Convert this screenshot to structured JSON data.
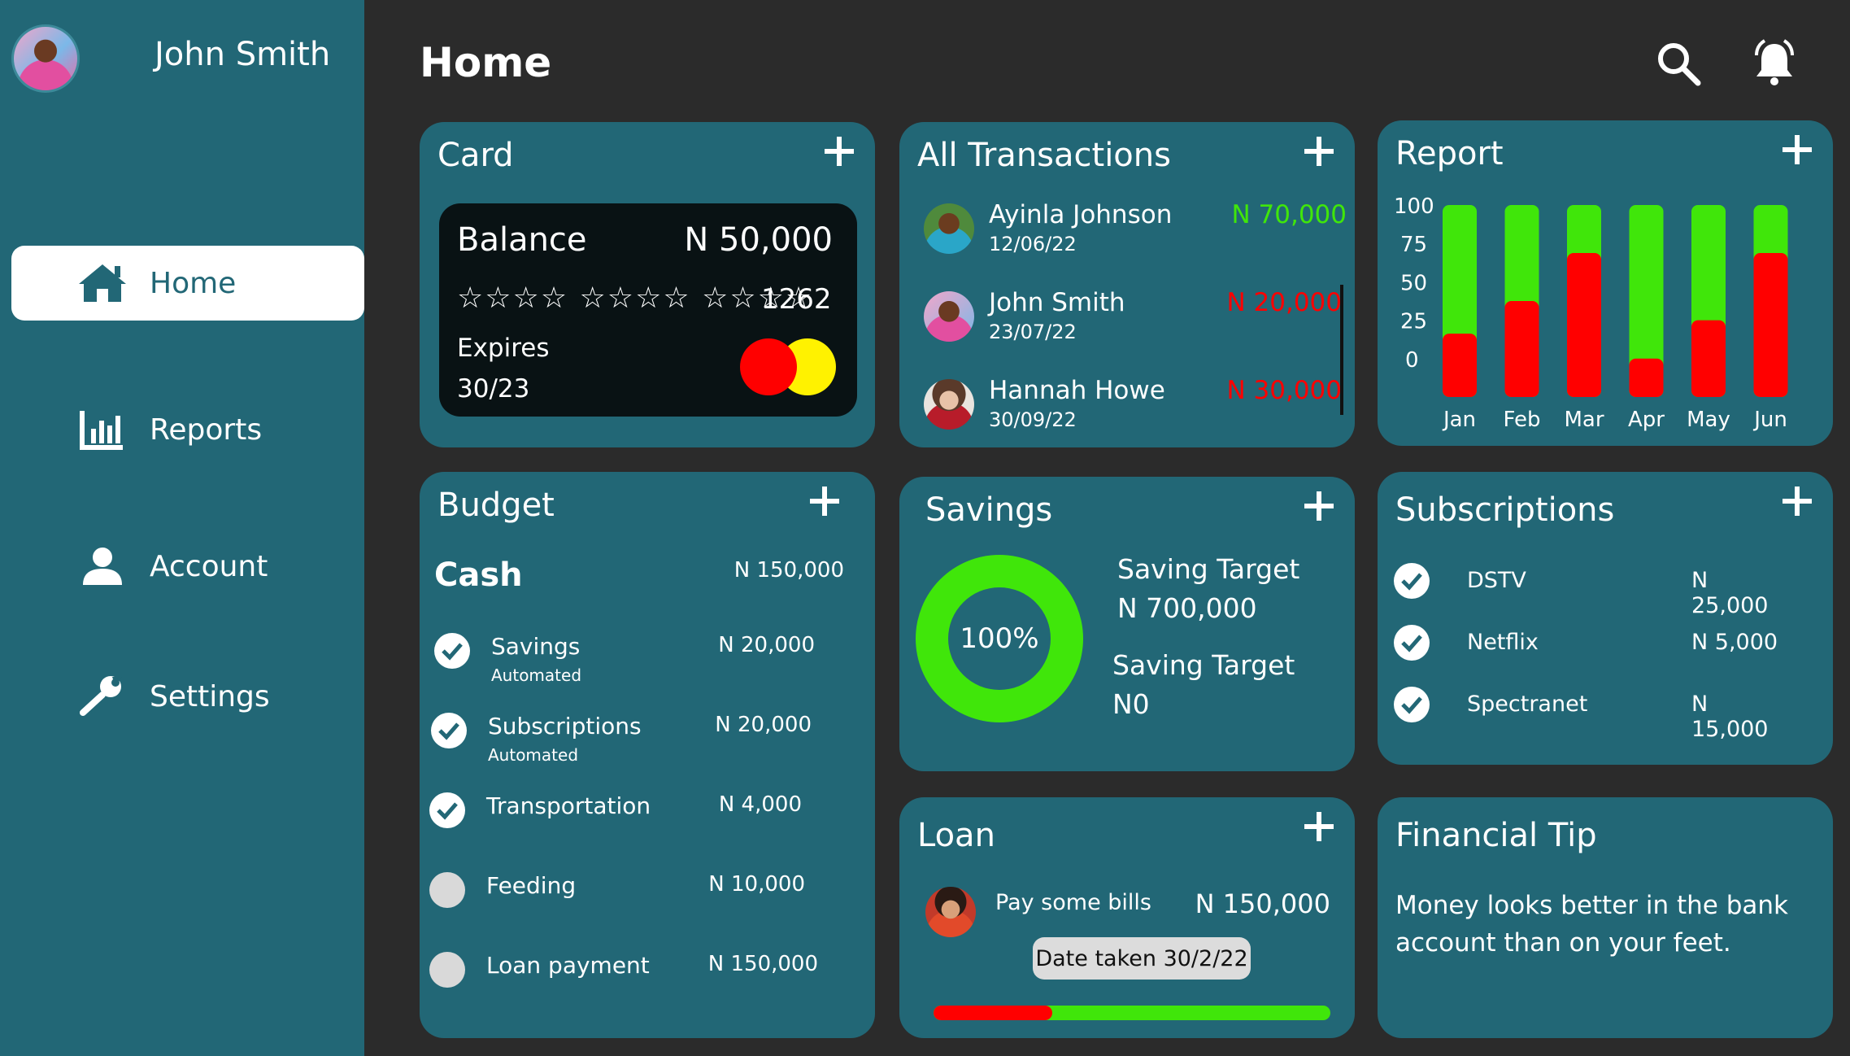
{
  "user": {
    "name": "John Smith"
  },
  "sidebar": {
    "items": [
      {
        "label": "Home",
        "icon": "home-icon",
        "active": true
      },
      {
        "label": "Reports",
        "icon": "bar-chart-icon"
      },
      {
        "label": "Account",
        "icon": "user-icon"
      },
      {
        "label": "Settings",
        "icon": "wrench-icon"
      }
    ]
  },
  "header": {
    "title": "Home"
  },
  "card": {
    "title": "Card",
    "balance_label": "Balance",
    "balance": "N 50,000",
    "masked": "☆☆☆☆ ☆☆☆☆ ☆☆☆☆",
    "last4": "1262",
    "expires_label": "Expires",
    "expires": "30/23"
  },
  "transactions": {
    "title": "All Transactions",
    "items": [
      {
        "name": "Ayinla Johnson",
        "date": "12/06/22",
        "amount": "N 70,000",
        "color": "#40e60a"
      },
      {
        "name": "John  Smith",
        "date": "23/07/22",
        "amount": "N 20,000",
        "color": "#ff0000"
      },
      {
        "name": "Hannah Howe",
        "date": "30/09/22",
        "amount": "N 30,000",
        "color": "#ff0000"
      }
    ]
  },
  "report": {
    "title": "Report"
  },
  "chart_data": {
    "type": "bar",
    "categories": [
      "Jan",
      "Feb",
      "Mar",
      "Apr",
      "May",
      "Jun"
    ],
    "series": [
      {
        "values": [
          33,
          50,
          75,
          20,
          40,
          75
        ],
        "color": "#ff0000"
      },
      {
        "values": [
          100,
          100,
          100,
          100,
          100,
          100
        ],
        "color": "#40e60a"
      }
    ],
    "yticks": [
      "100",
      "75",
      "50",
      "25",
      "0"
    ],
    "ylim": [
      0,
      100
    ]
  },
  "budget": {
    "title": "Budget",
    "cash_label": "Cash",
    "cash_amount": "N 150,000",
    "items": [
      {
        "name": "Savings",
        "sub": "Automated",
        "amount": "N 20,000",
        "checked": true
      },
      {
        "name": "Subscriptions",
        "sub": "Automated",
        "amount": "N 20,000",
        "checked": true
      },
      {
        "name": "Transportation",
        "sub": "",
        "amount": "N 4,000",
        "checked": true
      },
      {
        "name": "Feeding",
        "sub": "",
        "amount": "N 10,000",
        "checked": false
      },
      {
        "name": "Loan payment",
        "sub": "",
        "amount": "N 150,000",
        "checked": false
      }
    ]
  },
  "savings": {
    "title": "Savings",
    "percent": "100%",
    "target_label_1": "Saving Target",
    "target_value_1": "N 700,000",
    "target_label_2": "Saving Target",
    "target_value_2": "N0"
  },
  "subscriptions": {
    "title": "Subscriptions",
    "items": [
      {
        "name": "DSTV",
        "amount": "N 25,000"
      },
      {
        "name": "Netflix",
        "amount": "N 5,000"
      },
      {
        "name": "Spectranet",
        "amount": "N 15,000"
      }
    ]
  },
  "loan": {
    "title": "Loan",
    "description": "Pay  some bills",
    "amount": "N 150,000",
    "date_taken": "Date taken 30/2/22",
    "repaid_fraction": 0.3
  },
  "tip": {
    "title": "Financial Tip",
    "text": "Money looks better in the  bank account than on your feet."
  },
  "colors": {
    "sidebar": "#226776",
    "background": "#2b2b2b",
    "green": "#40e60a",
    "red": "#ff0000"
  }
}
